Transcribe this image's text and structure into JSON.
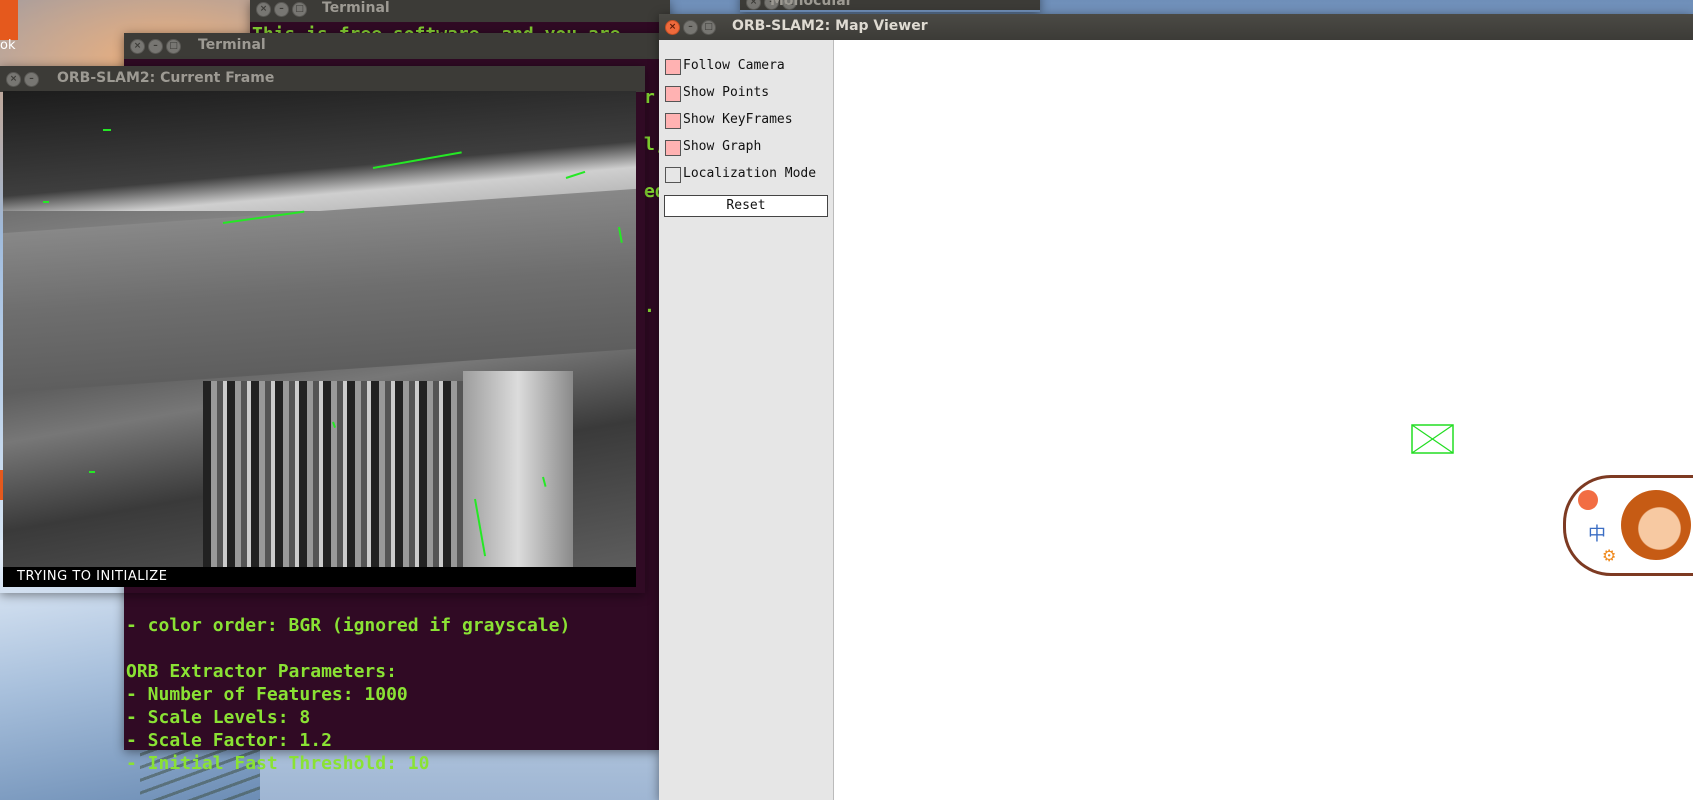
{
  "desktop": {
    "label": "ok"
  },
  "terminal_back": {
    "title": "Terminal",
    "first_line": "This is free software, and you are"
  },
  "terminal_monocular": {
    "title": "Monocular"
  },
  "terminal_front": {
    "title": "Terminal",
    "partial_right_chars": [
      "r",
      "l,",
      "ed",
      "."
    ],
    "lines": [
      "- color order: BGR (ignored if grayscale)",
      "",
      "ORB Extractor Parameters:",
      "- Number of Features: 1000",
      "- Scale Levels: 8",
      "- Scale Factor: 1.2",
      "- Initial Fast Threshold: 10"
    ]
  },
  "current_frame": {
    "title": "ORB-SLAM2: Current Frame",
    "status": "TRYING TO INITIALIZE"
  },
  "map_viewer": {
    "title": "ORB-SLAM2: Map Viewer",
    "options": [
      {
        "label": "Follow Camera",
        "checked": true
      },
      {
        "label": "Show Points",
        "checked": true
      },
      {
        "label": "Show KeyFrames",
        "checked": true
      },
      {
        "label": "Show Graph",
        "checked": true
      },
      {
        "label": "Localization Mode",
        "checked": false
      }
    ],
    "reset_label": "Reset"
  },
  "widget": {
    "ime_char": "中",
    "gear": "⚙"
  },
  "colors": {
    "terminal_bg": "#300a24",
    "terminal_text": "#8ae234",
    "checkbox_on": "#ffb2b2",
    "feature_line": "#25e825",
    "camera_frustum": "#22dd22"
  }
}
